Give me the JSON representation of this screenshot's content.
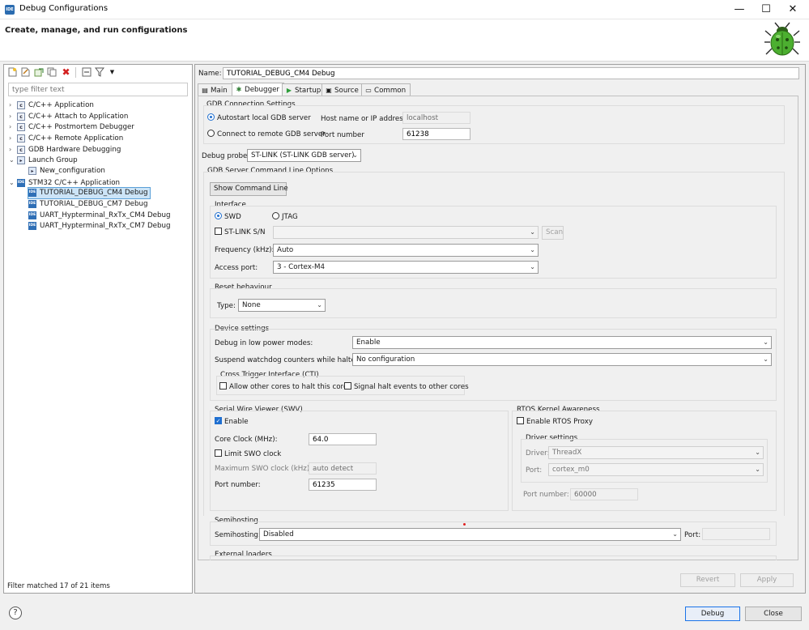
{
  "window": {
    "icon_text": "IDE",
    "title": "Debug Configurations",
    "minimize": "—",
    "maximize": "☐",
    "close": "✕"
  },
  "header": {
    "title": "Create, manage, and run configurations"
  },
  "left": {
    "filter_placeholder": "type filter text",
    "tree": [
      {
        "label": "C/C++ Application",
        "icon": "c-icon"
      },
      {
        "label": "C/C++ Attach to Application",
        "icon": "c-icon"
      },
      {
        "label": "C/C++ Postmortem Debugger",
        "icon": "c-icon"
      },
      {
        "label": "C/C++ Remote Application",
        "icon": "c-icon"
      },
      {
        "label": "GDB Hardware Debugging",
        "icon": "c-icon"
      },
      {
        "label": "Launch Group",
        "icon": "launch-group-icon"
      },
      {
        "label": "New_configuration",
        "icon": "launch-config-icon"
      },
      {
        "label": "STM32 C/C++ Application",
        "icon": "ide-icon"
      },
      {
        "label": "TUTORIAL_DEBUG_CM4 Debug",
        "icon": "ide-icon"
      },
      {
        "label": "TUTORIAL_DEBUG_CM7 Debug",
        "icon": "ide-icon"
      },
      {
        "label": "UART_Hypterminal_RxTx_CM4 Debug",
        "icon": "ide-icon"
      },
      {
        "label": "UART_Hypterminal_RxTx_CM7 Debug",
        "icon": "ide-icon"
      }
    ],
    "status": "Filter matched 17 of 21 items"
  },
  "config": {
    "name_label": "Name:",
    "name_value": "TUTORIAL_DEBUG_CM4 Debug",
    "tabs": [
      "Main",
      "Debugger",
      "Startup",
      "Source",
      "Common"
    ],
    "active_tab": "Debugger"
  },
  "gdb": {
    "section": "GDB Connection Settings",
    "autostart": "Autostart local GDB server",
    "remote": "Connect to remote GDB server",
    "host_label": "Host name or IP address",
    "host_value": "localhost",
    "port_label": "Port number",
    "port_value": "61238"
  },
  "probe": {
    "label": "Debug probe",
    "value": "ST-LINK (ST-LINK GDB server)"
  },
  "server_opts": {
    "section": "GDB Server Command Line Options",
    "show_cmd": "Show Command Line",
    "interface_section": "Interface",
    "swd": "SWD",
    "jtag": "JTAG",
    "stlink_sn": "ST-LINK S/N",
    "scan": "Scan",
    "freq_label": "Frequency (kHz):",
    "freq_value": "Auto",
    "access_label": "Access port:",
    "access_value": "3 - Cortex-M4"
  },
  "reset": {
    "section": "Reset behaviour",
    "type_label": "Type:",
    "type_value": "None"
  },
  "device": {
    "section": "Device settings",
    "low_power_label": "Debug in low power modes:",
    "low_power_value": "Enable",
    "watchdog_label": "Suspend watchdog counters while halted:",
    "watchdog_value": "No configuration",
    "cti_section": "Cross Trigger Interface (CTI)",
    "cti_allow": "Allow other cores to halt this core",
    "cti_signal": "Signal halt events to other cores"
  },
  "swv": {
    "section": "Serial Wire Viewer (SWV)",
    "enable": "Enable",
    "core_clock_label": "Core Clock (MHz):",
    "core_clock_value": "64.0",
    "limit_swo": "Limit SWO clock",
    "max_swo_label": "Maximum SWO clock (kHz):",
    "max_swo_value": "auto detect",
    "port_label": "Port number:",
    "port_value": "61235"
  },
  "rtos": {
    "section": "RTOS Kernel Awareness",
    "enable_proxy": "Enable RTOS Proxy",
    "driver_section": "Driver settings",
    "driver_label": "Driver:",
    "driver_value": "ThreadX",
    "port_label": "Port:",
    "port_value": "cortex_m0",
    "port_number_label": "Port number:",
    "port_number_value": "60000"
  },
  "semihosting": {
    "section": "Semihosting",
    "label": "Semihosting:",
    "value": "Disabled",
    "port_label": "Port:"
  },
  "external": {
    "section": "External loaders"
  },
  "buttons": {
    "revert": "Revert",
    "apply": "Apply",
    "debug": "Debug",
    "close": "Close",
    "help": "?"
  },
  "colors": {
    "accent": "#1f6fd0",
    "selection": "#cce4f7",
    "bug": "#4caf30"
  }
}
